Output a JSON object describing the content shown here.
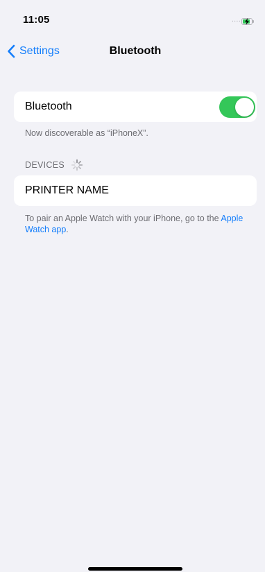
{
  "status_bar": {
    "time": "11:05",
    "signal": "....",
    "battery_level": 0.8,
    "battery_charging": true
  },
  "nav": {
    "back_label": "Settings",
    "title": "Bluetooth"
  },
  "bluetooth_toggle": {
    "label": "Bluetooth",
    "enabled": true,
    "on_color": "#34c759"
  },
  "discoverable_text": "Now discoverable as “iPhoneX”.",
  "devices_section": {
    "header": "DEVICES",
    "loading_icon": "spinner-icon",
    "items": [
      {
        "label": "PRINTER NAME"
      }
    ]
  },
  "pairing_note": {
    "text": "To pair an Apple Watch with your iPhone, go to the ",
    "link_text": "Apple Watch app",
    "trailing": "."
  },
  "colors": {
    "accent": "#147efb",
    "background": "#f2f2f7",
    "secondary_text": "#6d6d72"
  }
}
